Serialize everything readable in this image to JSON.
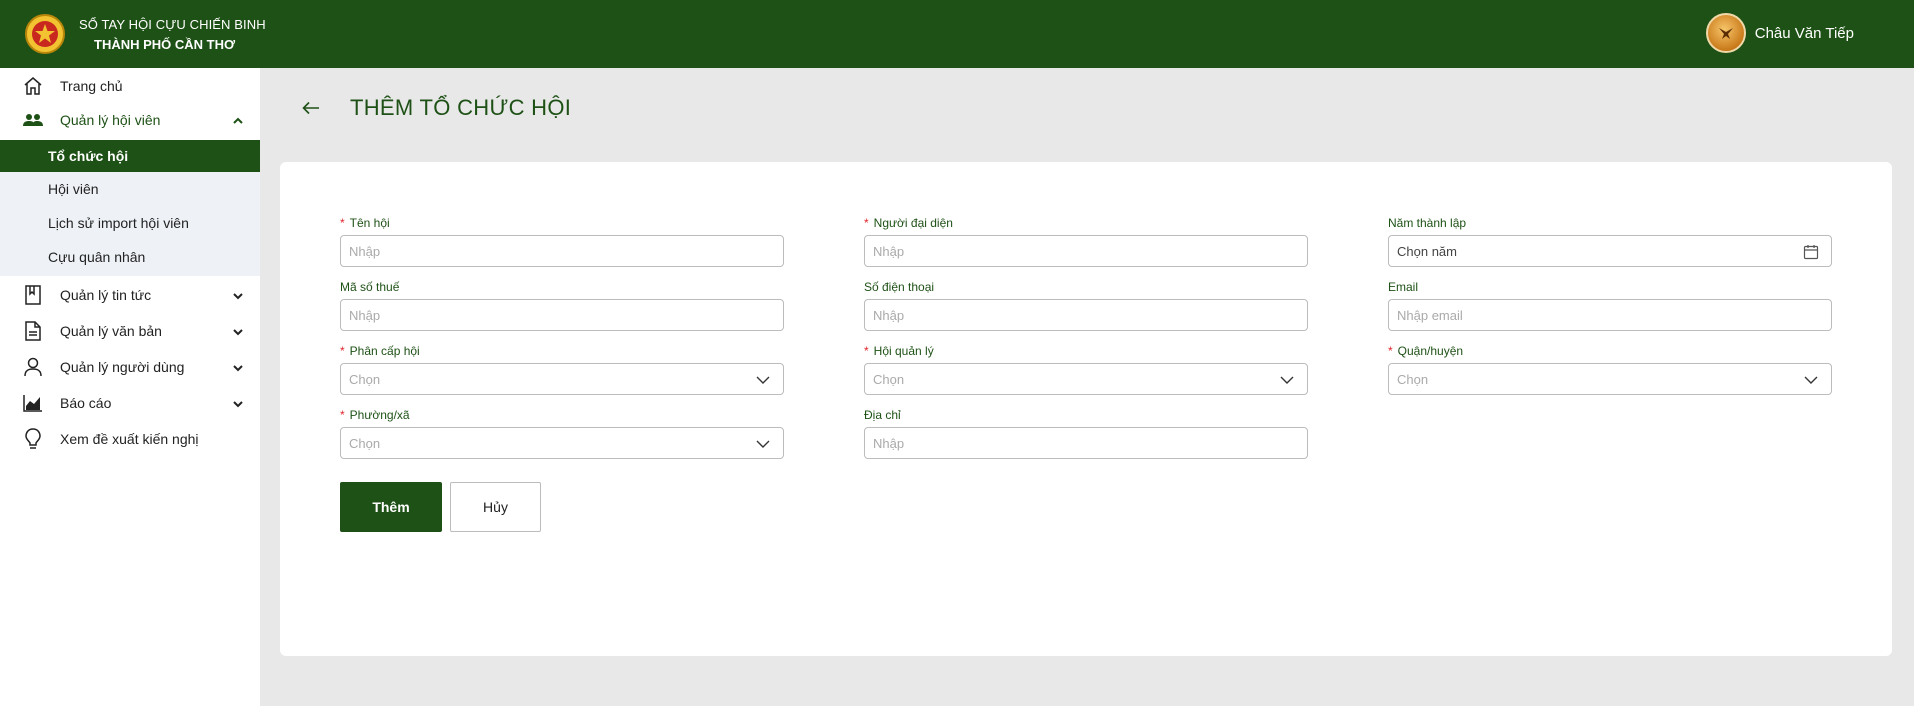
{
  "header": {
    "title_line1": "SỔ TAY HỘI CỰU CHIẾN BINH",
    "title_line2": "THÀNH PHỐ CẦN THƠ",
    "user_name": "Châu Văn Tiếp"
  },
  "sidebar": {
    "items": [
      {
        "label": "Trang chủ",
        "icon": "home-icon"
      },
      {
        "label": "Quản lý hội viên",
        "icon": "users-icon"
      },
      {
        "label": "Quản lý tin tức",
        "icon": "bookmark-icon"
      },
      {
        "label": "Quản lý văn bản",
        "icon": "document-icon"
      },
      {
        "label": "Quản lý người dùng",
        "icon": "user-icon"
      },
      {
        "label": "Báo cáo",
        "icon": "chart-icon"
      },
      {
        "label": "Xem đề xuất kiến nghị",
        "icon": "lightbulb-icon"
      }
    ],
    "sub_items": [
      {
        "label": "Tổ chức hội",
        "active": true
      },
      {
        "label": "Hội viên"
      },
      {
        "label": "Lịch sử import hội viên"
      },
      {
        "label": "Cựu quân nhân"
      }
    ]
  },
  "page": {
    "title": "THÊM TỔ CHỨC HỘI"
  },
  "form": {
    "ten_hoi": {
      "label": "Tên hội",
      "placeholder": "Nhập",
      "required": true
    },
    "nguoi_dai_dien": {
      "label": "Người đại diện",
      "placeholder": "Nhập",
      "required": true
    },
    "nam_thanh_lap": {
      "label": "Năm thành lập",
      "placeholder": "Chọn năm"
    },
    "ma_so_thue": {
      "label": "Mã số thuế",
      "placeholder": "Nhập"
    },
    "so_dien_thoai": {
      "label": "Số điện thoại",
      "placeholder": "Nhập"
    },
    "email": {
      "label": "Email",
      "placeholder": "Nhập email"
    },
    "phan_cap_hoi": {
      "label": "Phân cấp hội",
      "placeholder": "Chọn",
      "required": true
    },
    "hoi_quan_ly": {
      "label": "Hội quản lý",
      "placeholder": "Chọn",
      "required": true
    },
    "quan_huyen": {
      "label": "Quận/huyện",
      "placeholder": "Chọn",
      "required": true
    },
    "phuong_xa": {
      "label": "Phường/xã",
      "placeholder": "Chọn",
      "required": true
    },
    "dia_chi": {
      "label": "Địa chỉ",
      "placeholder": "Nhập"
    }
  },
  "buttons": {
    "submit": "Thêm",
    "cancel": "Hủy"
  },
  "colors": {
    "primary": "#1e5116",
    "required": "#e0242b",
    "background": "#e8e8e8"
  }
}
